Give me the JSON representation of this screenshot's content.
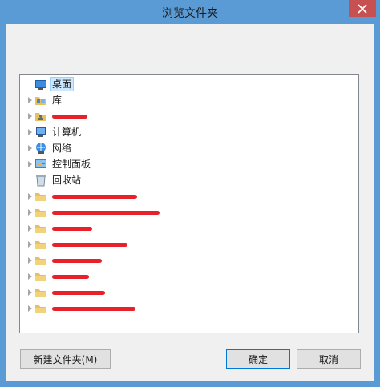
{
  "window": {
    "title": "浏览文件夹"
  },
  "tree": {
    "items": [
      {
        "label": "桌面",
        "icon": "desktop-icon",
        "expandable": false,
        "selected": true
      },
      {
        "label": "库",
        "icon": "library-icon",
        "expandable": true
      },
      {
        "label": "",
        "icon": "user-folder-icon",
        "expandable": true,
        "redacted": true
      },
      {
        "label": "计算机",
        "icon": "computer-icon",
        "expandable": true
      },
      {
        "label": "网络",
        "icon": "network-icon",
        "expandable": true
      },
      {
        "label": "控制面板",
        "icon": "control-panel-icon",
        "expandable": true
      },
      {
        "label": "回收站",
        "icon": "recycle-bin-icon",
        "expandable": false
      },
      {
        "label": "",
        "icon": "folder-icon",
        "expandable": true,
        "redacted": true
      },
      {
        "label": "",
        "icon": "folder-icon",
        "expandable": true,
        "redacted": true
      },
      {
        "label": "",
        "icon": "folder-icon",
        "expandable": true,
        "redacted": true
      },
      {
        "label": "",
        "icon": "folder-icon",
        "expandable": true,
        "redacted": true
      },
      {
        "label": "",
        "icon": "folder-icon",
        "expandable": true,
        "redacted": true
      },
      {
        "label": "",
        "icon": "folder-icon",
        "expandable": true,
        "redacted": true
      },
      {
        "label": "",
        "icon": "folder-icon",
        "expandable": true,
        "redacted": true
      },
      {
        "label": "",
        "icon": "folder-icon",
        "expandable": true,
        "redacted": true
      }
    ]
  },
  "buttons": {
    "new_folder": "新建文件夹(M)",
    "ok": "确定",
    "cancel": "取消"
  },
  "colors": {
    "frame": "#5b9bd5",
    "close": "#c75050",
    "redaction": "#e8202a",
    "selection": "#cce8ff"
  }
}
